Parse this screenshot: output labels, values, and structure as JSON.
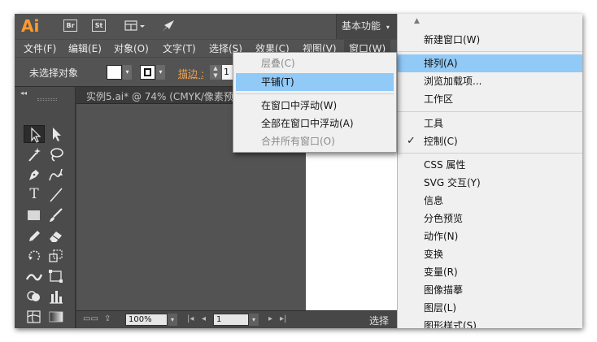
{
  "app": {
    "logo": "Ai",
    "bridge_label": "Br",
    "stock_label": "St",
    "workspace_label": "基本功能"
  },
  "menubar": {
    "items": [
      "文件(F)",
      "编辑(E)",
      "对象(O)",
      "文字(T)",
      "选择(S)",
      "效果(C)",
      "视图(V)",
      "窗口(W)"
    ]
  },
  "control": {
    "no_selection": "未选择对象",
    "fill_color": "#ffffff",
    "stroke_label": "描边 :",
    "stroke_value": "1"
  },
  "document": {
    "tab_label": "实例5.ai* @ 74% (CMYK/像素预"
  },
  "statusbar": {
    "zoom": "100%",
    "page": "1",
    "status": "选择"
  },
  "window_menu": {
    "items": [
      {
        "label": "新建窗口(W)",
        "state": "normal"
      },
      {
        "label": "排列(A)",
        "state": "highlighted"
      },
      {
        "label": "浏览加载项...",
        "state": "normal"
      },
      {
        "label": "工作区",
        "state": "normal"
      },
      {
        "label": "工具",
        "state": "normal"
      },
      {
        "label": "控制(C)",
        "state": "checked"
      },
      {
        "label": "CSS 属性",
        "state": "normal"
      },
      {
        "label": "SVG 交互(Y)",
        "state": "normal"
      },
      {
        "label": "信息",
        "state": "normal"
      },
      {
        "label": "分色预览",
        "state": "normal"
      },
      {
        "label": "动作(N)",
        "state": "normal"
      },
      {
        "label": "变换",
        "state": "normal"
      },
      {
        "label": "变量(R)",
        "state": "normal"
      },
      {
        "label": "图像描摹",
        "state": "normal"
      },
      {
        "label": "图层(L)",
        "state": "normal"
      },
      {
        "label": "图形样式(S)",
        "state": "normal"
      }
    ]
  },
  "arrange_menu": {
    "items": [
      {
        "label": "层叠(C)",
        "state": "disabled"
      },
      {
        "label": "平铺(T)",
        "state": "highlighted"
      },
      {
        "label": "在窗口中浮动(W)",
        "state": "normal"
      },
      {
        "label": "全部在窗口中浮动(A)",
        "state": "normal"
      },
      {
        "label": "合并所有窗口(O)",
        "state": "disabled"
      }
    ]
  },
  "colors": {
    "accent_logo": "#ff9a2e",
    "highlight": "#91c9f7",
    "stroke_label": "#f0a24e"
  },
  "tools": [
    "selection-tool",
    "direct-selection-tool",
    "magic-wand-tool",
    "lasso-tool",
    "pen-tool",
    "curvature-tool",
    "type-tool",
    "line-segment-tool",
    "rectangle-tool",
    "paintbrush-tool",
    "pencil-tool",
    "eraser-tool",
    "rotate-tool",
    "scale-tool",
    "width-tool",
    "free-transform-tool",
    "shape-builder-tool",
    "graph-tool",
    "mesh-tool",
    "gradient-tool",
    "eyedropper-tool",
    "blend-tool"
  ]
}
